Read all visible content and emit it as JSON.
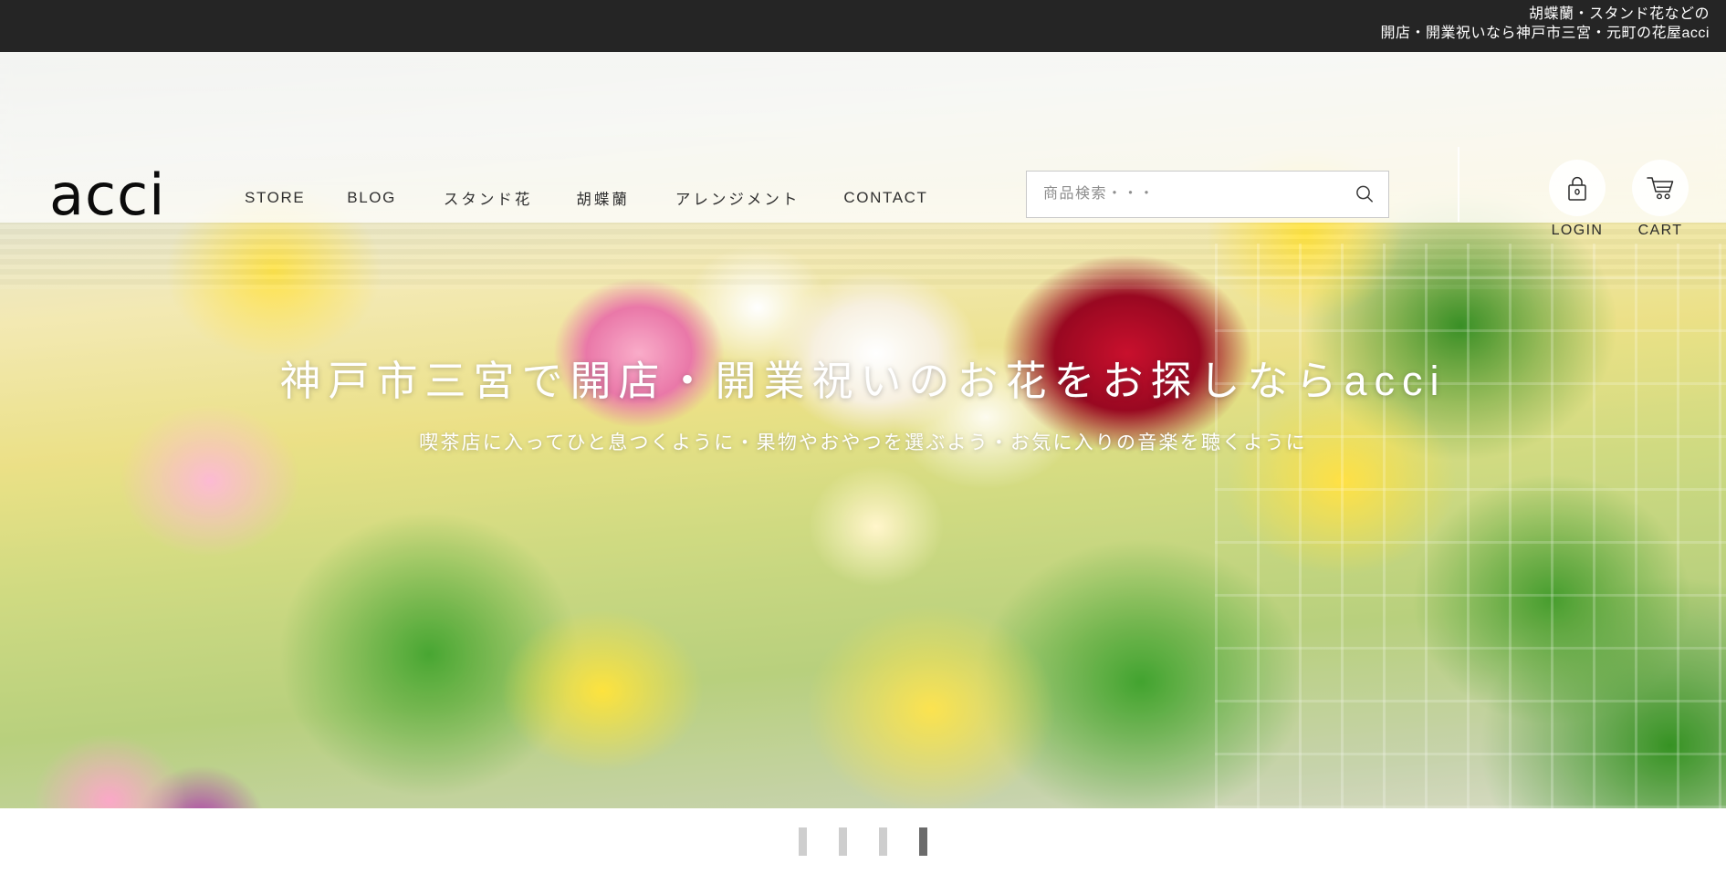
{
  "topbar": {
    "line1": "胡蝶蘭・スタンド花などの",
    "line2": "開店・開業祝いなら神戸市三宮・元町の花屋acci",
    "bg_color": "#252525",
    "text_color": "#ffffff"
  },
  "header": {
    "logo": "acci",
    "nav": [
      {
        "label": "STORE",
        "lang": "en"
      },
      {
        "label": "BLOG",
        "lang": "en"
      },
      {
        "label": "スタンド花",
        "lang": "jp"
      },
      {
        "label": "胡蝶蘭",
        "lang": "jp"
      },
      {
        "label": "アレンジメント",
        "lang": "jp"
      },
      {
        "label": "CONTACT",
        "lang": "en"
      }
    ],
    "search": {
      "placeholder": "商品検索・・・",
      "value": "",
      "icon": "search-icon"
    },
    "account": [
      {
        "label": "LOGIN",
        "icon": "lock-icon"
      },
      {
        "label": "CART",
        "icon": "cart-icon"
      }
    ]
  },
  "hero": {
    "title": "神戸市三宮で開店・開業祝いのお花をお探しならacci",
    "subtitle": "喫茶店に入ってひと息つくように・果物やおやつを選ぶよう・お気に入りの音楽を聴くように",
    "text_color": "#ffffff"
  },
  "slider": {
    "slides": [
      {
        "index": "1",
        "active": false
      },
      {
        "index": "2",
        "active": false
      },
      {
        "index": "3",
        "active": false
      },
      {
        "index": "4",
        "active": true
      }
    ],
    "inactive_color": "#cecece",
    "active_color": "#6b6b6b"
  }
}
